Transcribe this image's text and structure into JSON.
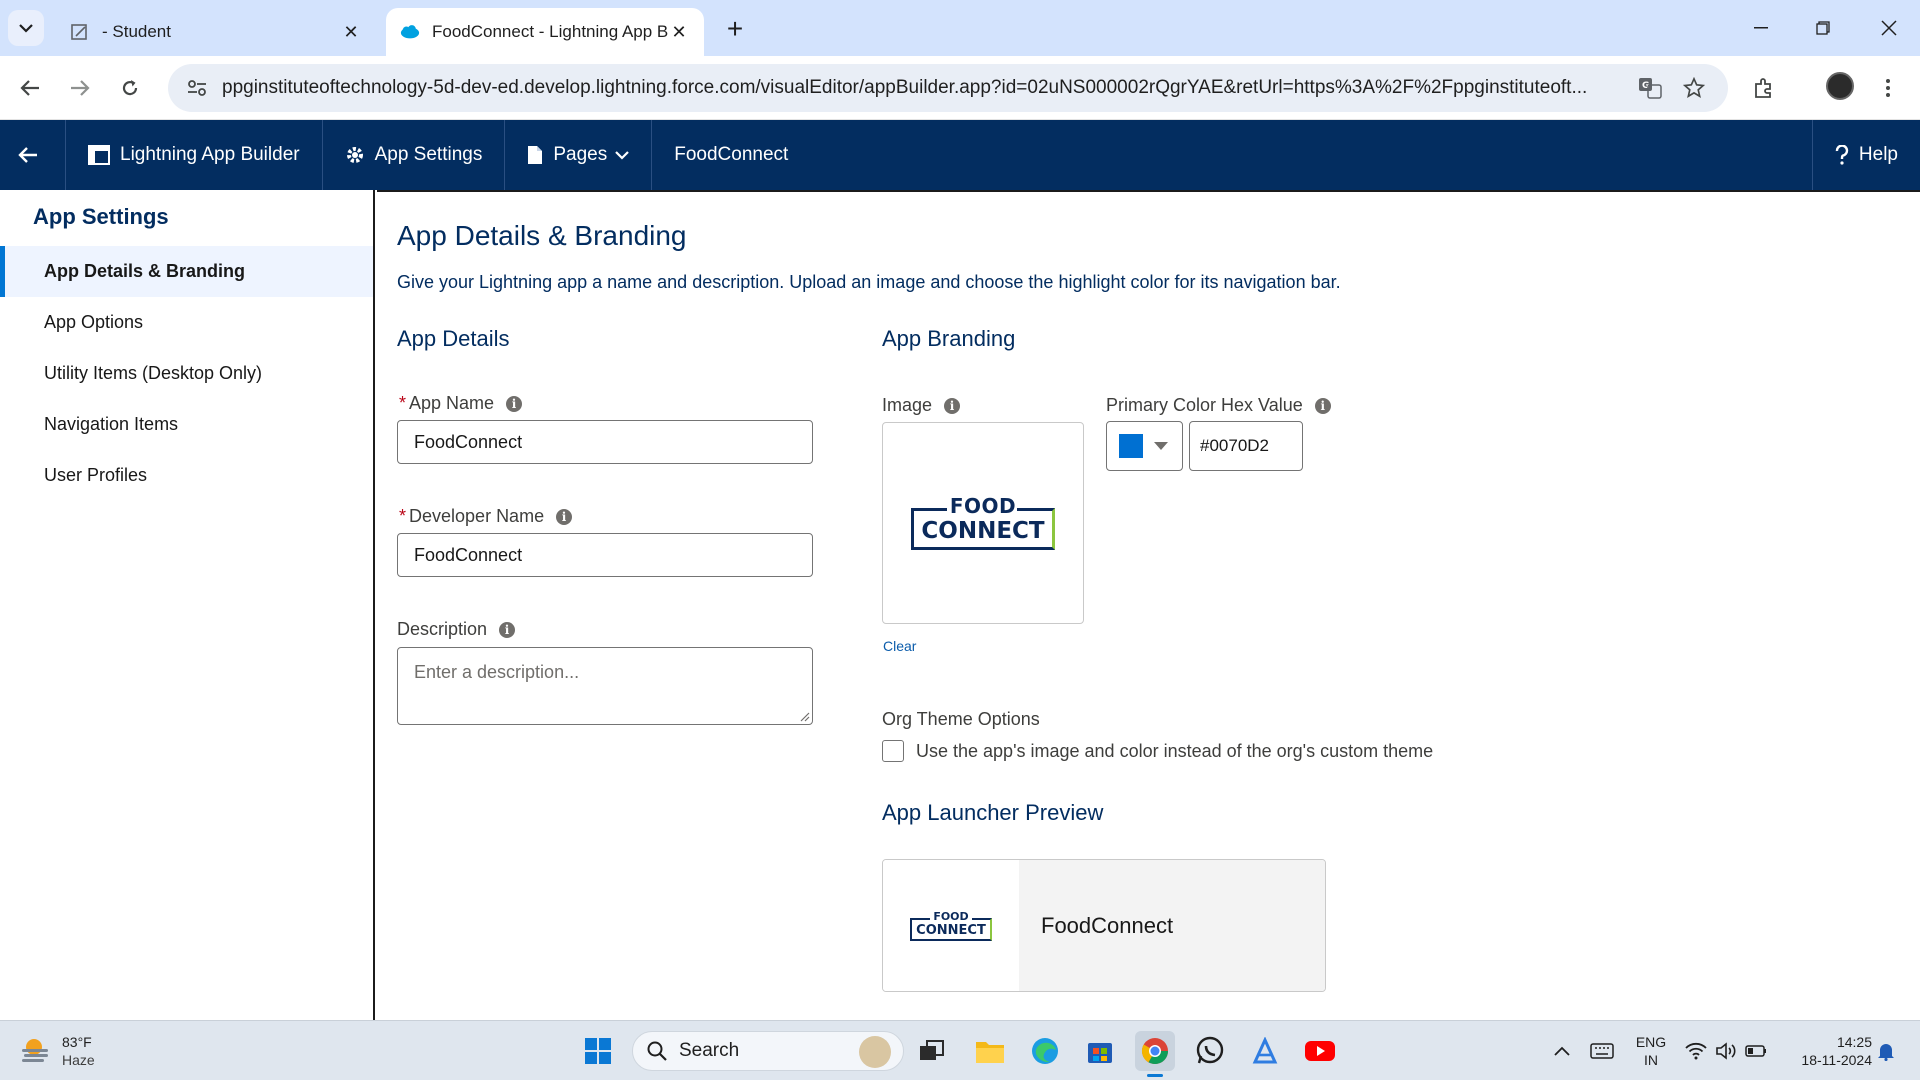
{
  "browser": {
    "tabs": [
      {
        "title": " - Student"
      },
      {
        "title": "FoodConnect - Lightning App Builder"
      }
    ],
    "url": "ppginstituteoftechnology-5d-dev-ed.develop.lightning.force.com/visualEditor/appBuilder.app?id=02uNS000002rQgrYAE&retUrl=https%3A%2F%2Fppginstituteoft..."
  },
  "appbar": {
    "builder_label": "Lightning App Builder",
    "settings_label": "App Settings",
    "pages_label": "Pages",
    "app_name": "FoodConnect",
    "help_label": "Help"
  },
  "sidebar": {
    "title": "App Settings",
    "items": [
      {
        "label": "App Details & Branding"
      },
      {
        "label": "App Options"
      },
      {
        "label": "Utility Items (Desktop Only)"
      },
      {
        "label": "Navigation Items"
      },
      {
        "label": "User Profiles"
      }
    ]
  },
  "main": {
    "title": "App Details & Branding",
    "description": "Give your Lightning app a name and description. Upload an image and choose the highlight color for its navigation bar.",
    "details": {
      "heading": "App Details",
      "app_name_label": "App Name",
      "app_name_value": "FoodConnect",
      "dev_name_label": "Developer Name",
      "dev_name_value": "FoodConnect",
      "description_label": "Description",
      "description_placeholder": "Enter a description..."
    },
    "branding": {
      "heading": "App Branding",
      "image_label": "Image",
      "logo_line1": "FOOD",
      "logo_line2": "CONNECT",
      "clear_label": "Clear",
      "color_label": "Primary Color Hex Value",
      "color_hex": "#0070D2",
      "swatch_color": "#0070d2",
      "org_theme_heading": "Org Theme Options",
      "org_theme_checkbox": "Use the app's image and color instead of the org's custom theme",
      "launcher_heading": "App Launcher Preview",
      "launcher_name": "FoodConnect"
    }
  },
  "taskbar": {
    "temperature": "83°F",
    "condition": "Haze",
    "search_label": "Search",
    "lang_top": "ENG",
    "lang_bottom": "IN",
    "time": "14:25",
    "date": "18-11-2024"
  }
}
